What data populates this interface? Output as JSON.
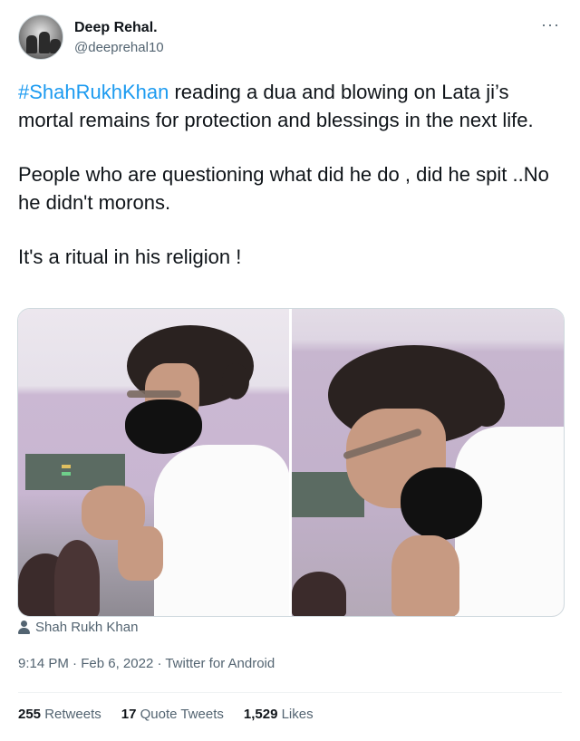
{
  "author": {
    "display_name": "Deep Rehal.",
    "handle": "@deeprehal10",
    "avatar_icon": "avatar-image"
  },
  "more_icon": "more-dots-icon",
  "tweet": {
    "hashtag": "#ShahRukhKhan",
    "line1_rest": " reading a dua and blowing on Lata ji’s mortal remains for protection and blessings in the next life.",
    "paragraph2": "People who are questioning what did he  do , did he spit ..No he didn't morons.",
    "paragraph3": "It's a ritual in his religion !"
  },
  "media": {
    "tagged_person": "Shah Rukh Khan",
    "tag_icon": "person-icon"
  },
  "meta": {
    "time": "9:14 PM",
    "date": "Feb 6, 2022",
    "source": "Twitter for Android",
    "separator": " · "
  },
  "stats": {
    "retweets_count": "255",
    "retweets_label": "Retweets",
    "quotes_count": "17",
    "quotes_label": "Quote Tweets",
    "likes_count": "1,529",
    "likes_label": "Likes"
  },
  "colors": {
    "link": "#1d9bf0",
    "secondary_text": "#536471",
    "primary_text": "#0f1419",
    "border": "#eff3f4"
  }
}
